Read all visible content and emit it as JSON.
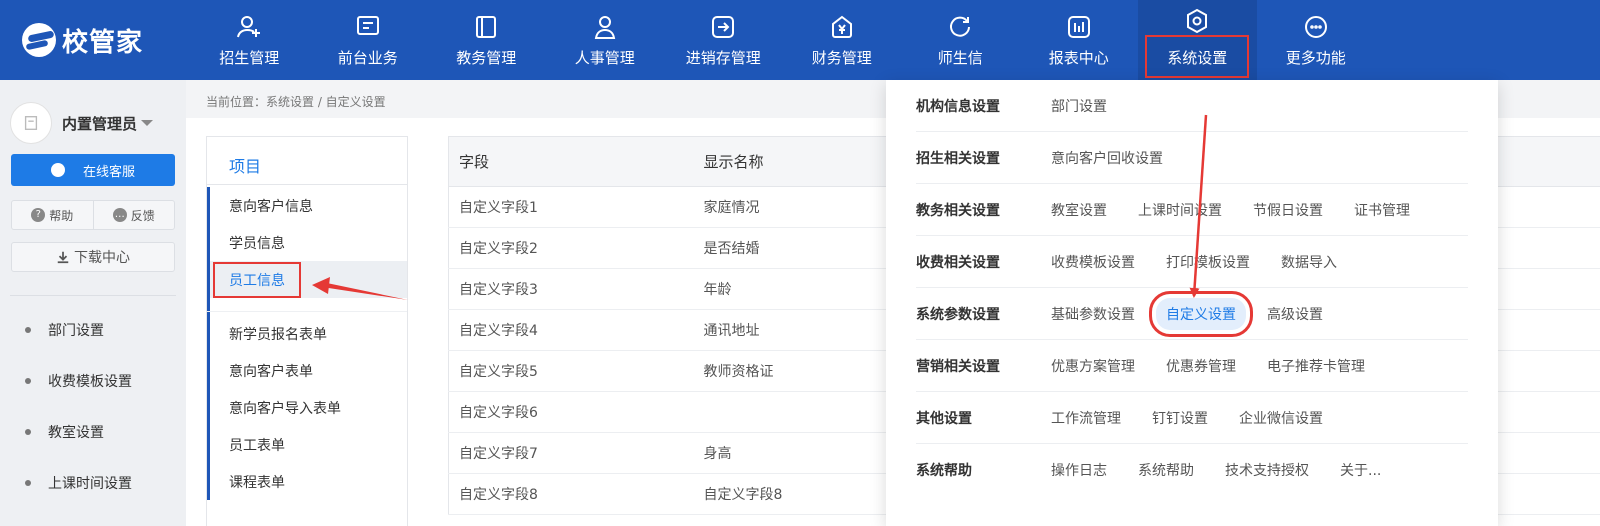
{
  "app": {
    "logo_text": "校管家"
  },
  "nav": [
    {
      "label": "招生管理",
      "icon": "add-user-icon"
    },
    {
      "label": "前台业务",
      "icon": "monitor-icon"
    },
    {
      "label": "教务管理",
      "icon": "book-icon"
    },
    {
      "label": "人事管理",
      "icon": "person-icon"
    },
    {
      "label": "进销存管理",
      "icon": "export-icon"
    },
    {
      "label": "财务管理",
      "icon": "yen-bag-icon"
    },
    {
      "label": "师生信",
      "icon": "chat-icon"
    },
    {
      "label": "报表中心",
      "icon": "report-icon"
    },
    {
      "label": "系统设置",
      "icon": "settings-icon",
      "active": true
    },
    {
      "label": "更多功能",
      "icon": "more-icon"
    }
  ],
  "sidebar": {
    "user_name": "内置管理员",
    "service_label": "在线客服",
    "help_label": "帮助",
    "feedback_label": "反馈",
    "download_label": "下载中心",
    "quick_links": [
      "部门设置",
      "收费模板设置",
      "教室设置",
      "上课时间设置"
    ]
  },
  "breadcrumb": "当前位置：系统设置 / 自定义设置",
  "project_panel": {
    "title": "项目",
    "group1": [
      "意向客户信息",
      "学员信息",
      "员工信息"
    ],
    "active": "员工信息",
    "group2": [
      "新学员报名表单",
      "意向客户表单",
      "意向客户导入表单",
      "员工表单",
      "课程表单"
    ]
  },
  "table": {
    "headers": [
      "字段",
      "显示名称"
    ],
    "rows": [
      [
        "自定义字段1",
        "家庭情况"
      ],
      [
        "自定义字段2",
        "是否结婚"
      ],
      [
        "自定义字段3",
        "年龄"
      ],
      [
        "自定义字段4",
        "通讯地址"
      ],
      [
        "自定义字段5",
        "教师资格证"
      ],
      [
        "自定义字段6",
        ""
      ],
      [
        "自定义字段7",
        "身高"
      ],
      [
        "自定义字段8",
        "自定义字段8"
      ]
    ]
  },
  "mega_menu": [
    {
      "category": "机构信息设置",
      "links": [
        "部门设置"
      ]
    },
    {
      "category": "招生相关设置",
      "links": [
        "意向客户回收设置"
      ]
    },
    {
      "category": "教务相关设置",
      "links": [
        "教室设置",
        "上课时间设置",
        "节假日设置",
        "证书管理"
      ]
    },
    {
      "category": "收费相关设置",
      "links": [
        "收费模板设置",
        "打印模板设置",
        "数据导入"
      ]
    },
    {
      "category": "系统参数设置",
      "links": [
        "基础参数设置",
        "自定义设置",
        "高级设置"
      ]
    },
    {
      "category": "营销相关设置",
      "links": [
        "优惠方案管理",
        "优惠券管理",
        "电子推荐卡管理"
      ]
    },
    {
      "category": "其他设置",
      "links": [
        "工作流管理",
        "钉钉设置",
        "企业微信设置"
      ]
    },
    {
      "category": "系统帮助",
      "links": [
        "操作日志",
        "系统帮助",
        "技术支持授权",
        "关于..."
      ]
    }
  ],
  "colors": {
    "primary": "#1e56b7",
    "accent": "#1e7be6",
    "annotation": "#e53935"
  }
}
